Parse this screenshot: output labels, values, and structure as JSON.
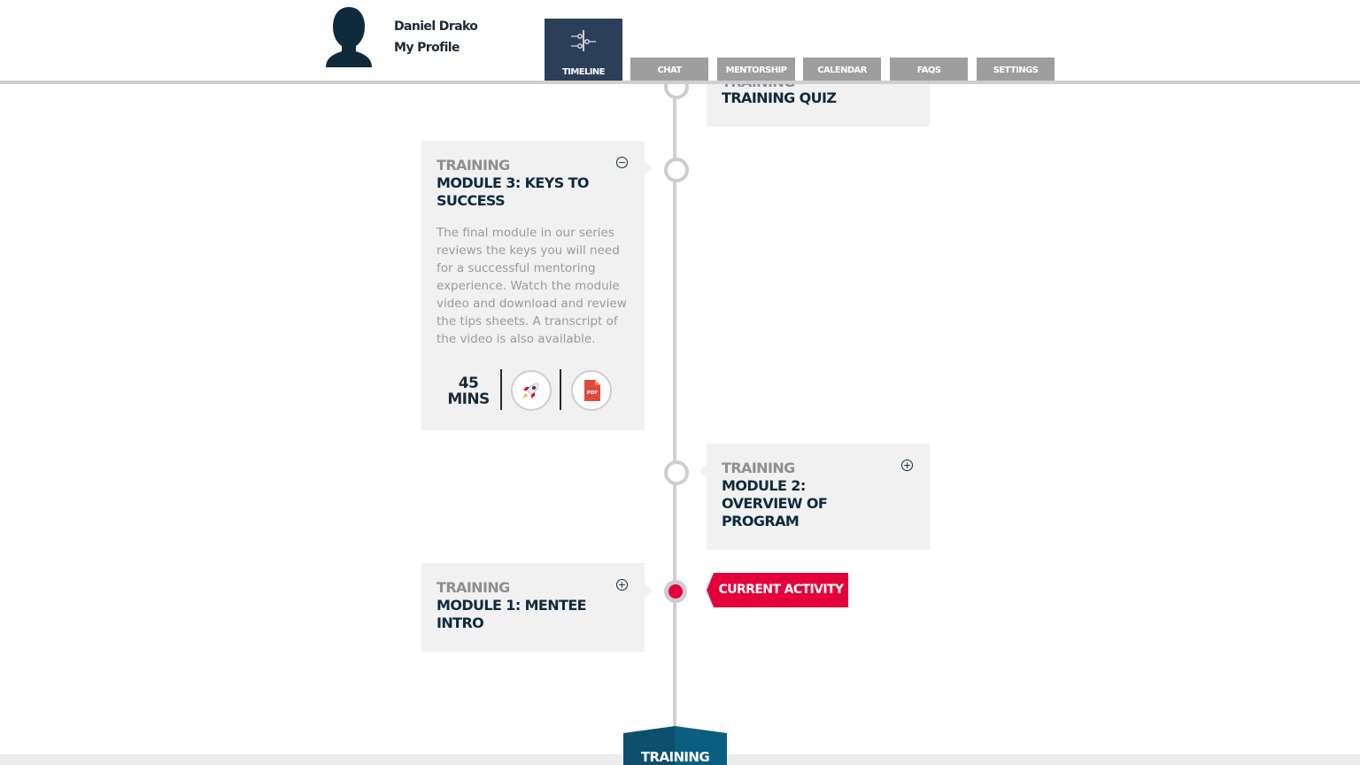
{
  "user": {
    "name": "Daniel Drako",
    "profile_link": "My Profile"
  },
  "nav": {
    "tabs": [
      {
        "label": "TIMELINE",
        "active": true,
        "icon": "timeline-icon"
      },
      {
        "label": "CHAT",
        "active": false
      },
      {
        "label": "MENTORSHIP",
        "active": false
      },
      {
        "label": "CALENDAR",
        "active": false
      },
      {
        "label": "FAQS",
        "active": false
      },
      {
        "label": "SETTINGS",
        "active": false
      }
    ]
  },
  "timeline": {
    "quiz": {
      "category": "TRAINING",
      "title": "TRAINING QUIZ"
    },
    "module3": {
      "category": "TRAINING",
      "title_line1": "MODULE 3: KEYS TO",
      "title_line2": "SUCCESS",
      "description": "The final module in our series reviews the keys you will need for a successful mentoring experience. Watch the module video and download and review the tips sheets. A transcript of the video is also available.",
      "duration_value": "45",
      "duration_unit": "MINS",
      "toggle": "⊖",
      "pdf_label": "PDF"
    },
    "module2": {
      "category": "TRAINING",
      "title_line1": "MODULE 2:",
      "title_line2": "OVERVIEW OF",
      "title_line3": "PROGRAM",
      "toggle": "+"
    },
    "module1": {
      "category": "TRAINING",
      "title_line1": "MODULE 1: MENTEE",
      "title_line2": "INTRO",
      "toggle": "+"
    },
    "current_label": "CURRENT ACTIVITY"
  },
  "footer": {
    "tab_label": "TRAINING"
  },
  "colors": {
    "navy": "#0f2a3c",
    "accent_red": "#e4003b",
    "tab_gray": "#9e9e9e",
    "tab_active": "#2b4058",
    "footer_teal": "#0a5f80"
  }
}
